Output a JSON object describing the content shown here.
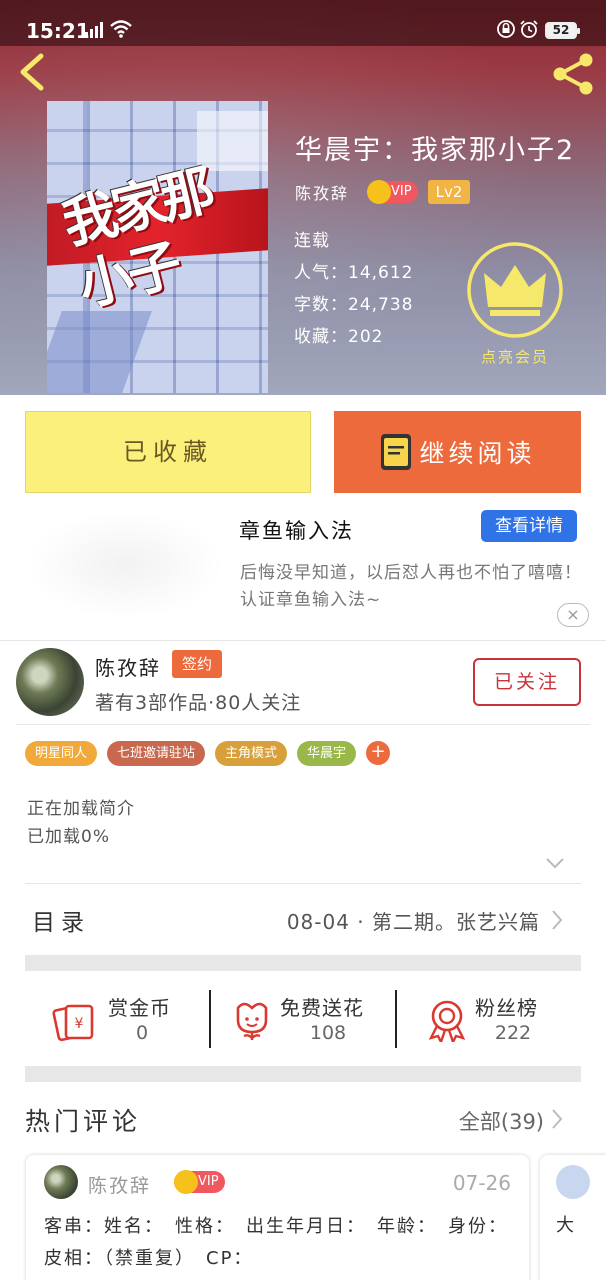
{
  "status_bar": {
    "time": "15:21",
    "battery": "52"
  },
  "book": {
    "cover_title": "我家那小子",
    "title": "华晨宇：我家那小子2",
    "author": "陈孜辞",
    "vip_label": "VIP",
    "level": "Lv2",
    "serial_status": "连载",
    "popularity_label": "人气：",
    "popularity": "14,612",
    "word_count_label": "字数：",
    "word_count": "24,738",
    "favorites_label": "收藏：",
    "favorites": "202",
    "member_label": "点亮会员"
  },
  "actions": {
    "collected": "已收藏",
    "continue_reading": "继续阅读"
  },
  "ad": {
    "title": "章鱼输入法",
    "detail_button": "查看详情",
    "description": "后悔没早知道，以后怼人再也不怕了嘻嘻！认证章鱼输入法~",
    "close": "×"
  },
  "author_block": {
    "name": "陈孜辞",
    "badge": "签约",
    "stats": "著有3部作品·80人关注",
    "follow_button": "已关注"
  },
  "tags": [
    {
      "label": "明星同人",
      "color": "#f2a93b"
    },
    {
      "label": "七班邀请驻站",
      "color": "#c8694f"
    },
    {
      "label": "主角模式",
      "color": "#d7a03a"
    },
    {
      "label": "华晨宇",
      "color": "#9ab84a"
    }
  ],
  "tag_more": "+",
  "intro": {
    "line1": "正在加载简介",
    "line2": "已加载0%"
  },
  "toc": {
    "label": "目录",
    "latest": "08-04 · 第二期。张艺兴篇"
  },
  "stats": [
    {
      "label": "赏金币",
      "value": "0"
    },
    {
      "label": "免费送花",
      "value": "108"
    },
    {
      "label": "粉丝榜",
      "value": "222"
    }
  ],
  "comments": {
    "title": "热门评论",
    "all_link": "全部(39)",
    "items": [
      {
        "user": "陈孜辞",
        "vip": "VIP",
        "date": "07-26",
        "text": "客串：姓名：　性格：　出生年月日：　年龄：　身份：　皮相：（禁重复）　CP："
      },
      {
        "text": "大"
      }
    ]
  },
  "colors": {
    "accent_orange": "#ec6a3c",
    "collected_yellow": "#fbf07c",
    "follow_red": "#c8333a",
    "ad_blue": "#2f73e6"
  }
}
